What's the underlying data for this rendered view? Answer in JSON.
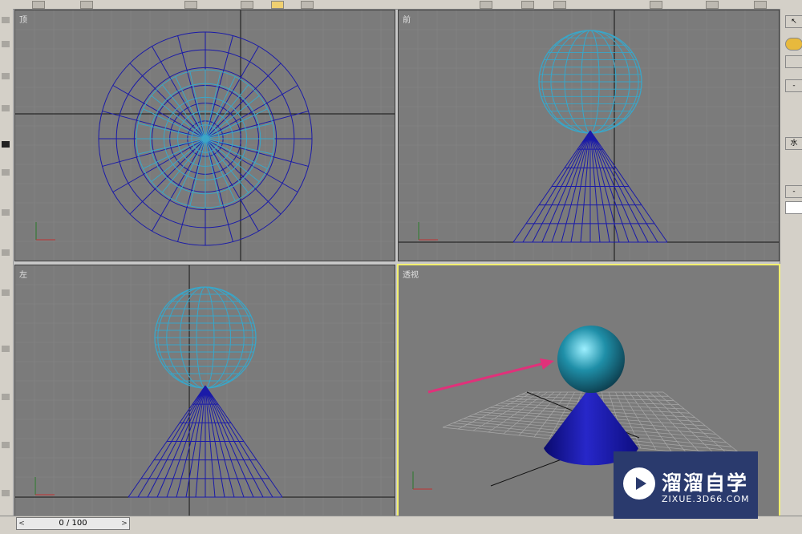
{
  "viewports": {
    "top": {
      "label": "顶"
    },
    "front": {
      "label": "前"
    },
    "left": {
      "label": "左"
    },
    "perspective": {
      "label": "透视"
    }
  },
  "time_slider": {
    "value": "0 / 100"
  },
  "right_panel": {
    "minus1": "-",
    "minus2": "-",
    "char": "水"
  },
  "colors": {
    "viewport_bg": "#7b7b7b",
    "grid": "#878787",
    "cone_wire": "#1a1aa8",
    "sphere_wire": "#3aa6c8",
    "active_border": "#f3f06e",
    "arrow": "#e0317a"
  },
  "watermark": {
    "title": "溜溜自学",
    "url": "ZIXUE.3D66.COM"
  }
}
